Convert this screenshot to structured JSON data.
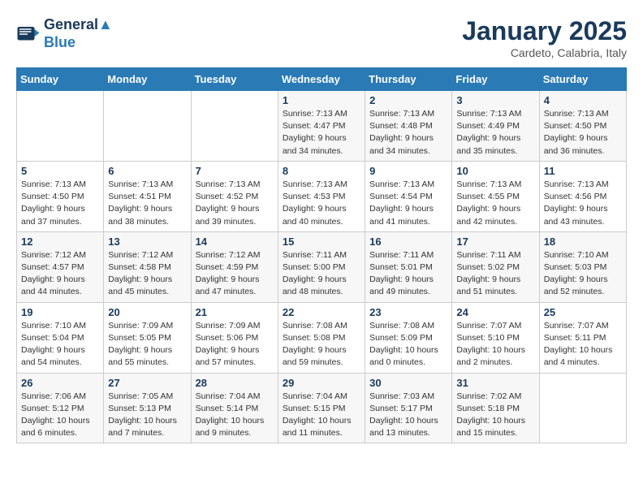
{
  "header": {
    "logo_line1": "General",
    "logo_line2": "Blue",
    "month": "January 2025",
    "location": "Cardeto, Calabria, Italy"
  },
  "days_of_week": [
    "Sunday",
    "Monday",
    "Tuesday",
    "Wednesday",
    "Thursday",
    "Friday",
    "Saturday"
  ],
  "weeks": [
    [
      {
        "day": "",
        "info": ""
      },
      {
        "day": "",
        "info": ""
      },
      {
        "day": "",
        "info": ""
      },
      {
        "day": "1",
        "info": "Sunrise: 7:13 AM\nSunset: 4:47 PM\nDaylight: 9 hours\nand 34 minutes."
      },
      {
        "day": "2",
        "info": "Sunrise: 7:13 AM\nSunset: 4:48 PM\nDaylight: 9 hours\nand 34 minutes."
      },
      {
        "day": "3",
        "info": "Sunrise: 7:13 AM\nSunset: 4:49 PM\nDaylight: 9 hours\nand 35 minutes."
      },
      {
        "day": "4",
        "info": "Sunrise: 7:13 AM\nSunset: 4:50 PM\nDaylight: 9 hours\nand 36 minutes."
      }
    ],
    [
      {
        "day": "5",
        "info": "Sunrise: 7:13 AM\nSunset: 4:50 PM\nDaylight: 9 hours\nand 37 minutes."
      },
      {
        "day": "6",
        "info": "Sunrise: 7:13 AM\nSunset: 4:51 PM\nDaylight: 9 hours\nand 38 minutes."
      },
      {
        "day": "7",
        "info": "Sunrise: 7:13 AM\nSunset: 4:52 PM\nDaylight: 9 hours\nand 39 minutes."
      },
      {
        "day": "8",
        "info": "Sunrise: 7:13 AM\nSunset: 4:53 PM\nDaylight: 9 hours\nand 40 minutes."
      },
      {
        "day": "9",
        "info": "Sunrise: 7:13 AM\nSunset: 4:54 PM\nDaylight: 9 hours\nand 41 minutes."
      },
      {
        "day": "10",
        "info": "Sunrise: 7:13 AM\nSunset: 4:55 PM\nDaylight: 9 hours\nand 42 minutes."
      },
      {
        "day": "11",
        "info": "Sunrise: 7:13 AM\nSunset: 4:56 PM\nDaylight: 9 hours\nand 43 minutes."
      }
    ],
    [
      {
        "day": "12",
        "info": "Sunrise: 7:12 AM\nSunset: 4:57 PM\nDaylight: 9 hours\nand 44 minutes."
      },
      {
        "day": "13",
        "info": "Sunrise: 7:12 AM\nSunset: 4:58 PM\nDaylight: 9 hours\nand 45 minutes."
      },
      {
        "day": "14",
        "info": "Sunrise: 7:12 AM\nSunset: 4:59 PM\nDaylight: 9 hours\nand 47 minutes."
      },
      {
        "day": "15",
        "info": "Sunrise: 7:11 AM\nSunset: 5:00 PM\nDaylight: 9 hours\nand 48 minutes."
      },
      {
        "day": "16",
        "info": "Sunrise: 7:11 AM\nSunset: 5:01 PM\nDaylight: 9 hours\nand 49 minutes."
      },
      {
        "day": "17",
        "info": "Sunrise: 7:11 AM\nSunset: 5:02 PM\nDaylight: 9 hours\nand 51 minutes."
      },
      {
        "day": "18",
        "info": "Sunrise: 7:10 AM\nSunset: 5:03 PM\nDaylight: 9 hours\nand 52 minutes."
      }
    ],
    [
      {
        "day": "19",
        "info": "Sunrise: 7:10 AM\nSunset: 5:04 PM\nDaylight: 9 hours\nand 54 minutes."
      },
      {
        "day": "20",
        "info": "Sunrise: 7:09 AM\nSunset: 5:05 PM\nDaylight: 9 hours\nand 55 minutes."
      },
      {
        "day": "21",
        "info": "Sunrise: 7:09 AM\nSunset: 5:06 PM\nDaylight: 9 hours\nand 57 minutes."
      },
      {
        "day": "22",
        "info": "Sunrise: 7:08 AM\nSunset: 5:08 PM\nDaylight: 9 hours\nand 59 minutes."
      },
      {
        "day": "23",
        "info": "Sunrise: 7:08 AM\nSunset: 5:09 PM\nDaylight: 10 hours\nand 0 minutes."
      },
      {
        "day": "24",
        "info": "Sunrise: 7:07 AM\nSunset: 5:10 PM\nDaylight: 10 hours\nand 2 minutes."
      },
      {
        "day": "25",
        "info": "Sunrise: 7:07 AM\nSunset: 5:11 PM\nDaylight: 10 hours\nand 4 minutes."
      }
    ],
    [
      {
        "day": "26",
        "info": "Sunrise: 7:06 AM\nSunset: 5:12 PM\nDaylight: 10 hours\nand 6 minutes."
      },
      {
        "day": "27",
        "info": "Sunrise: 7:05 AM\nSunset: 5:13 PM\nDaylight: 10 hours\nand 7 minutes."
      },
      {
        "day": "28",
        "info": "Sunrise: 7:04 AM\nSunset: 5:14 PM\nDaylight: 10 hours\nand 9 minutes."
      },
      {
        "day": "29",
        "info": "Sunrise: 7:04 AM\nSunset: 5:15 PM\nDaylight: 10 hours\nand 11 minutes."
      },
      {
        "day": "30",
        "info": "Sunrise: 7:03 AM\nSunset: 5:17 PM\nDaylight: 10 hours\nand 13 minutes."
      },
      {
        "day": "31",
        "info": "Sunrise: 7:02 AM\nSunset: 5:18 PM\nDaylight: 10 hours\nand 15 minutes."
      },
      {
        "day": "",
        "info": ""
      }
    ]
  ]
}
